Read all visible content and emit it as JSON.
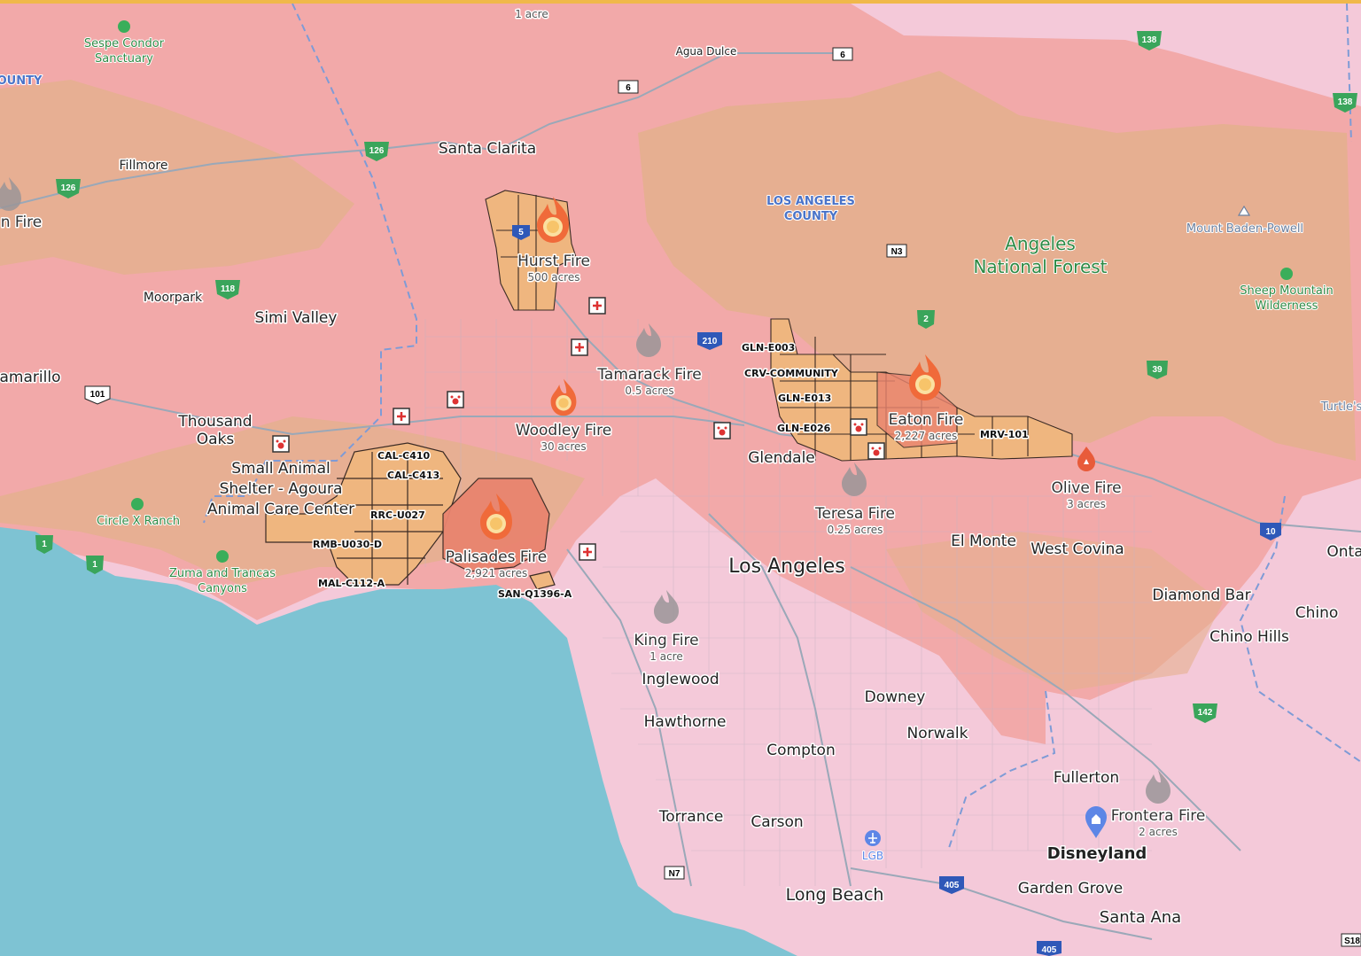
{
  "map": {
    "colors": {
      "land": "#f4c9d9",
      "red_flag": "#f2a9a9",
      "forest": "#e4b08d",
      "ocean": "#7ec3d3",
      "evac_zone": "#efb67f",
      "burn_area": "#e9846f",
      "road": "#9aa8b8",
      "county_line": "#7e9bd6",
      "park_green": "#3aae5a",
      "airport_blue": "#5d86e6"
    },
    "fires": [
      {
        "name": "Hurst Fire",
        "size": "500 acres",
        "icon": "fire-active-icon"
      },
      {
        "name": "Tamarack Fire",
        "size": "0.5 acres",
        "icon": "fire-contained-icon"
      },
      {
        "name": "Woodley Fire",
        "size": "30 acres",
        "icon": "fire-active-icon"
      },
      {
        "name": "Eaton Fire",
        "size": "2,227 acres",
        "icon": "fire-active-icon"
      },
      {
        "name": "Palisades Fire",
        "size": "2,921 acres",
        "icon": "fire-active-icon"
      },
      {
        "name": "Olive Fire",
        "size": "3 acres",
        "icon": "fire-small-icon"
      },
      {
        "name": "Teresa Fire",
        "size": "0.25 acres",
        "icon": "fire-contained-icon"
      },
      {
        "name": "King Fire",
        "size": "1 acre",
        "icon": "fire-contained-icon"
      },
      {
        "name": "Frontera Fire",
        "size": "2 acres",
        "icon": "fire-contained-icon"
      }
    ],
    "partial_labels": {
      "top_fire_acres": "1 acre",
      "left_fire": "n Fire",
      "county_left": "OUNTY",
      "camarillo": "amarillo",
      "ontario": "Onta",
      "turtle": "Turtle's"
    },
    "cities": {
      "santa_clarita": "Santa Clarita",
      "agua_dulce": "Agua Dulce",
      "fillmore": "Fillmore",
      "moorpark": "Moorpark",
      "simi_valley": "Simi Valley",
      "thousand_oaks": "Thousand\nOaks",
      "glendale": "Glendale",
      "los_angeles": "Los Angeles",
      "el_monte": "El Monte",
      "west_covina": "West Covina",
      "diamond_bar": "Diamond Bar",
      "chino": "Chino",
      "chino_hills": "Chino Hills",
      "inglewood": "Inglewood",
      "hawthorne": "Hawthorne",
      "downey": "Downey",
      "norwalk": "Norwalk",
      "compton": "Compton",
      "torrance": "Torrance",
      "carson": "Carson",
      "fullerton": "Fullerton",
      "disneyland": "Disneyland",
      "long_beach": "Long Beach",
      "garden_grove": "Garden Grove",
      "santa_ana": "Santa Ana"
    },
    "areas": {
      "la_county": "LOS ANGELES\nCOUNTY",
      "angeles_nf": "Angeles\nNational Forest",
      "mount_baden_powell": "Mount Baden-Powell",
      "sheep_mountain": "Sheep Mountain\nWilderness",
      "sespe_condor": "Sespe Condor\nSanctuary",
      "circle_x": "Circle X Ranch",
      "zuma": "Zuma and Trancas\nCanyons",
      "shelter": "Small Animal\nShelter - Agoura\nAnimal Care Center",
      "lgb": "LGB"
    },
    "zones": [
      "GLN-E003",
      "CRV-COMMUNITY",
      "GLN-E013",
      "GLN-E026",
      "MRV-101",
      "CAL-C410",
      "CAL-C413",
      "RRC-U027",
      "RMB-U030-D",
      "MAL-C112-A",
      "SAN-Q1396-A"
    ],
    "shields": [
      "6",
      "6",
      "126",
      "126",
      "118",
      "101",
      "210",
      "N3",
      "2",
      "39",
      "138",
      "138",
      "1",
      "1",
      "10",
      "142",
      "405",
      "405",
      "N7",
      "5",
      "S18"
    ]
  }
}
